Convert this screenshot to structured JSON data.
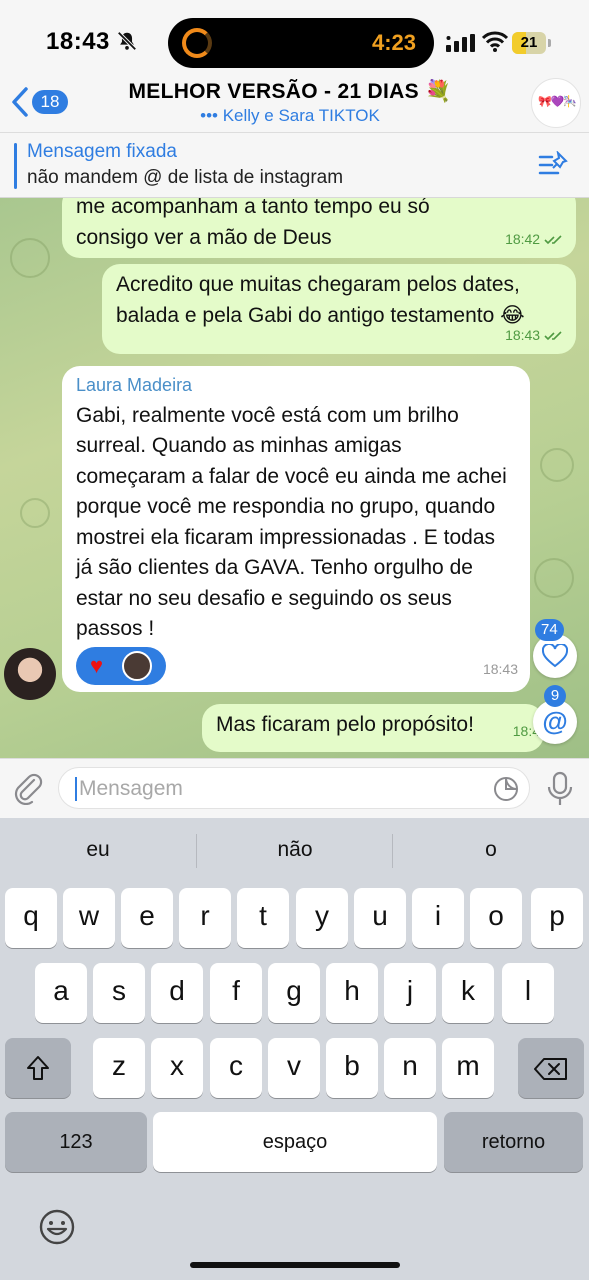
{
  "status": {
    "time": "18:43",
    "timer": "4:23",
    "battery": "21"
  },
  "header": {
    "back_count": "18",
    "title": "MELHOR VERSÃO - 21 DIAS 💐",
    "subtitle": "••• Kelly e Sara TIKTOK",
    "avatar_text": "🎀💜🎠"
  },
  "pinned": {
    "title": "Mensagem fixada",
    "text": "não mandem @ de lista de instagram"
  },
  "messages": [
    {
      "type": "out",
      "text": "me acompanham a tanto tempo eu só consigo ver a mão de Deus",
      "time": "18:42"
    },
    {
      "type": "out",
      "text": "Acredito que muitas chegaram pelos dates, balada e pela Gabi do antigo testamento 😂",
      "time": "18:43"
    },
    {
      "type": "in",
      "sender": "Laura Madeira",
      "text": "Gabi, realmente você está com um brilho surreal. Quando as minhas amigas começaram a falar de você eu ainda me achei porque você me respondia no grupo, quando mostrei ela ficaram impressionadas . E todas já são clientes da GAVA. Tenho orgulho de estar no seu desafio e seguindo os seus passos !",
      "time": "18:43",
      "reaction": "❤️"
    },
    {
      "type": "out",
      "text": "Mas ficaram pelo propósito!",
      "time": "18:4"
    }
  ],
  "floating": {
    "likes_badge": "74",
    "mentions_badge": "9"
  },
  "input": {
    "placeholder": "Mensagem"
  },
  "keyboard": {
    "suggestions": [
      "eu",
      "não",
      "o"
    ],
    "row1": [
      "q",
      "w",
      "e",
      "r",
      "t",
      "y",
      "u",
      "i",
      "o",
      "p"
    ],
    "row2": [
      "a",
      "s",
      "d",
      "f",
      "g",
      "h",
      "j",
      "k",
      "l"
    ],
    "row3": [
      "z",
      "x",
      "c",
      "v",
      "b",
      "n",
      "m"
    ],
    "numbers_key": "123",
    "space_key": "espaço",
    "return_key": "retorno"
  },
  "colors": {
    "accent": "#2f7de1",
    "outgoing_bubble": "#e4fbc9",
    "chat_bg": "#b7cf93",
    "keyboard_bg": "#d3d7dd"
  }
}
